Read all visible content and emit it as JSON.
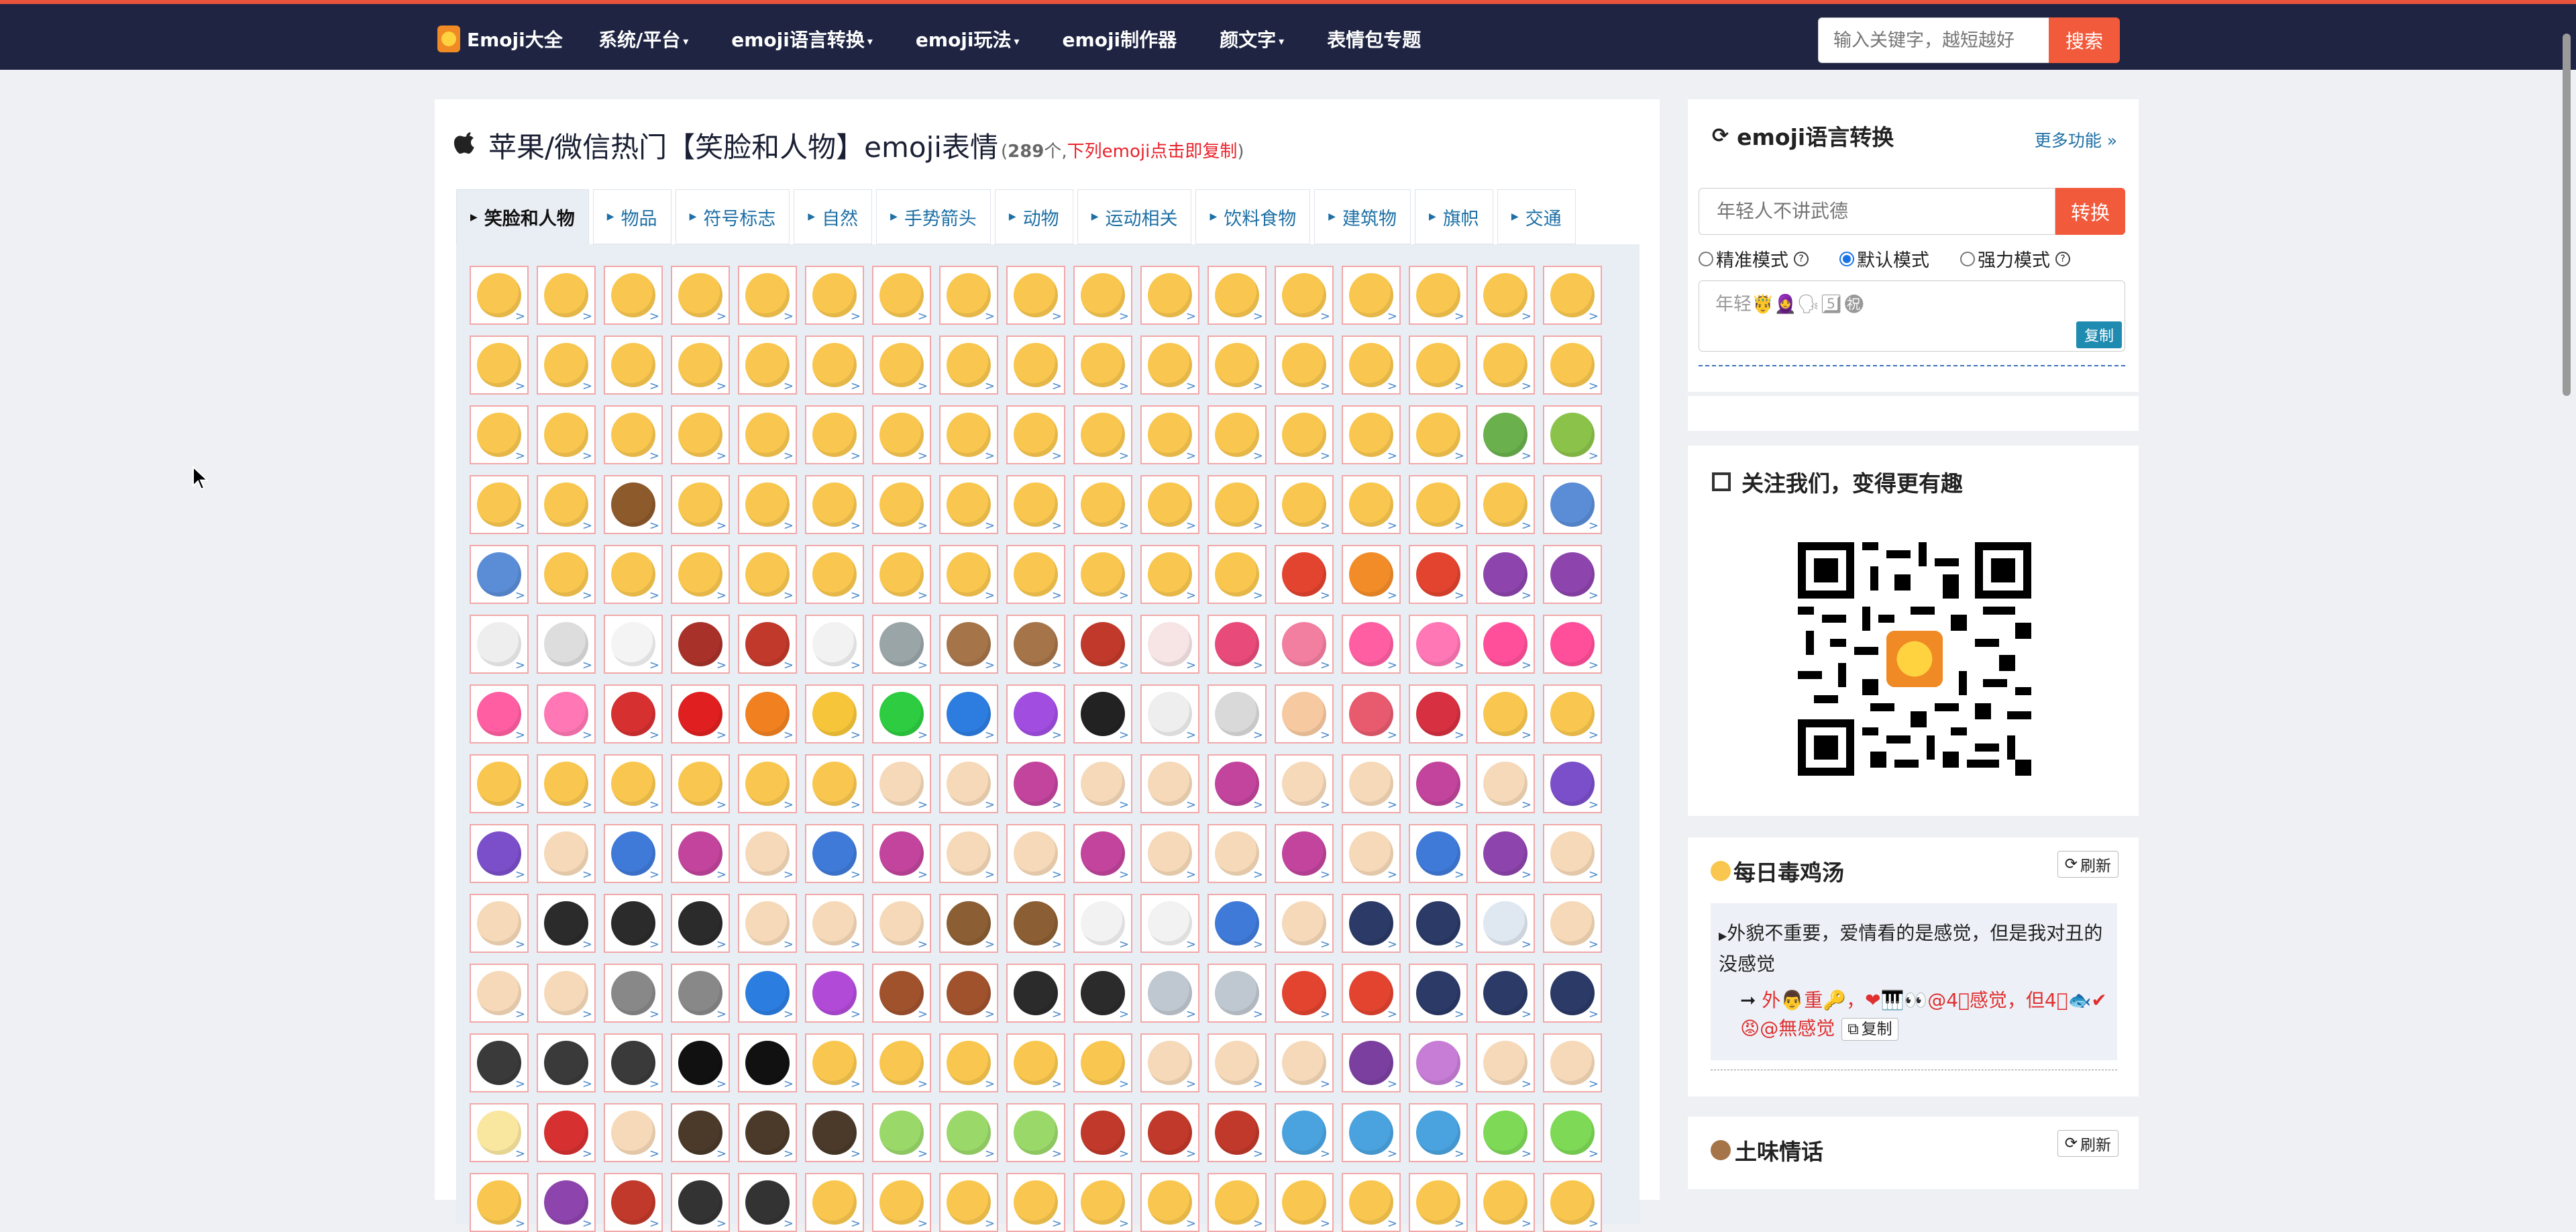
{
  "navbar": {
    "brand": "Emoji大全",
    "items": [
      {
        "label": "系统/平台",
        "dropdown": true
      },
      {
        "label": "emoji语言转换",
        "dropdown": true
      },
      {
        "label": "emoji玩法",
        "dropdown": true
      },
      {
        "label": "emoji制作器",
        "dropdown": false
      },
      {
        "label": "颜文字",
        "dropdown": true
      },
      {
        "label": "表情包专题",
        "dropdown": false
      }
    ],
    "search_placeholder": "输入关键字，越短越好",
    "search_button": "搜索"
  },
  "main": {
    "title": "苹果/微信热门【笑脸和人物】emoji表情",
    "count": "289",
    "count_suffix": "个,",
    "hint": "下列emoji点击即复制",
    "tabs": [
      {
        "label": "笑脸和人物",
        "active": true
      },
      {
        "label": "物品"
      },
      {
        "label": "符号标志"
      },
      {
        "label": "自然"
      },
      {
        "label": "手势箭头"
      },
      {
        "label": "动物"
      },
      {
        "label": "运动相关"
      },
      {
        "label": "饮料食物"
      },
      {
        "label": "建筑物"
      },
      {
        "label": "旗帜"
      },
      {
        "label": "交通"
      }
    ]
  },
  "emoji_grid": {
    "columns": 17,
    "rows": 14,
    "corner_glyph": ">",
    "colors": [
      "#f9c74f",
      "#f9c74f",
      "#f9c74f",
      "#f9c74f",
      "#f9c74f",
      "#f9c74f",
      "#f9c74f",
      "#f9c74f",
      "#f9c74f",
      "#f9c74f",
      "#f9c74f",
      "#f9c74f",
      "#f9c74f",
      "#f9c74f",
      "#f9c74f",
      "#f9c74f",
      "#f9c74f",
      "#f9c74f",
      "#f9c74f",
      "#f9c74f",
      "#f9c74f",
      "#f9c74f",
      "#f9c74f",
      "#f9c74f",
      "#f9c74f",
      "#f9c74f",
      "#f9c74f",
      "#f9c74f",
      "#f9c74f",
      "#f9c74f",
      "#f9c74f",
      "#f9c74f",
      "#f9c74f",
      "#f9c74f",
      "#f9c74f",
      "#f9c74f",
      "#f9c74f",
      "#f9c74f",
      "#f9c74f",
      "#f9c74f",
      "#f9c74f",
      "#f9c74f",
      "#f9c74f",
      "#f9c74f",
      "#f9c74f",
      "#f9c74f",
      "#f9c74f",
      "#f9c74f",
      "#f9c74f",
      "#6ab04c",
      "#8bc34a",
      "#f9c74f",
      "#f9c74f",
      "#8d5a2b",
      "#f9c74f",
      "#f9c74f",
      "#f9c74f",
      "#f9c74f",
      "#f9c74f",
      "#f9c74f",
      "#f9c74f",
      "#f9c74f",
      "#f9c74f",
      "#f9c74f",
      "#f9c74f",
      "#f9c74f",
      "#f9c74f",
      "#5b8dd6",
      "#5b8dd6",
      "#f9c74f",
      "#f9c74f",
      "#f9c74f",
      "#f9c74f",
      "#f9c74f",
      "#f9c74f",
      "#f9c74f",
      "#f9c74f",
      "#f9c74f",
      "#f9c74f",
      "#f9c74f",
      "#e2442f",
      "#f28c28",
      "#e2442f",
      "#8e44ad",
      "#8e44ad",
      "#eeeeee",
      "#dddddd",
      "#f4f4f4",
      "#a8322a",
      "#c0392b",
      "#f2f2f2",
      "#9aa5a8",
      "#a57449",
      "#a57449",
      "#c0392b",
      "#f7e4e4",
      "#e84a7a",
      "#f27ea0",
      "#ff5fa2",
      "#ff77b5",
      "#ff4f9a",
      "#ff4f9a",
      "#ff5fa2",
      "#ff77b5",
      "#d63031",
      "#e02020",
      "#f08020",
      "#f6c53a",
      "#2ecc40",
      "#2d7de0",
      "#a04de0",
      "#222222",
      "#eeeeee",
      "#d9d9d9",
      "#f7c9a0",
      "#e85b6f",
      "#d63041",
      "#f9c74f",
      "#f9c74f",
      "#f9c74f",
      "#f9c74f",
      "#f9c74f",
      "#f9c74f",
      "#f9c74f",
      "#f9c74f",
      "#f6d9b8",
      "#f6d9b8",
      "#c2449c",
      "#f6d9b8",
      "#f6d9b8",
      "#c2449c",
      "#f6d9b8",
      "#f6d9b8",
      "#c2449c",
      "#f6d9b8",
      "#7b4fc9",
      "#7b4fc9",
      "#f6d9b8",
      "#3f7ad8",
      "#c2449c",
      "#f6d9b8",
      "#3f7ad8",
      "#c2449c",
      "#f6d9b8",
      "#f6d9b8",
      "#c2449c",
      "#f6d9b8",
      "#f6d9b8",
      "#c2449c",
      "#f6d9b8",
      "#3f7ad8",
      "#8e44ad",
      "#f6d9b8",
      "#f6d9b8",
      "#2b2b2b",
      "#2b2b2b",
      "#2b2b2b",
      "#f6d9b8",
      "#f6d9b8",
      "#f6d9b8",
      "#8b5e34",
      "#8b5e34",
      "#f2f2f2",
      "#f2f2f2",
      "#3f7ad8",
      "#f6d9b8",
      "#2b3a67",
      "#2b3a67",
      "#dfe7f0",
      "#f6d9b8",
      "#f6d9b8",
      "#f6d9b8",
      "#888888",
      "#888888",
      "#2b7de0",
      "#b14ad6",
      "#a0522d",
      "#a0522d",
      "#2b2b2b",
      "#2b2b2b",
      "#bfc7d0",
      "#bfc7d0",
      "#e2442f",
      "#e2442f",
      "#2b3a67",
      "#2b3a67",
      "#2b3a67",
      "#3a3a3a",
      "#3a3a3a",
      "#3a3a3a",
      "#111111",
      "#111111",
      "#f9c74f",
      "#f9c74f",
      "#f9c74f",
      "#f9c74f",
      "#f9c74f",
      "#f6d9b8",
      "#f6d9b8",
      "#f6d9b8",
      "#7b3fa0",
      "#c77dd6",
      "#f6d9b8",
      "#f6d9b8",
      "#f9e79f",
      "#d63031",
      "#f6d9b8",
      "#4b3a2a",
      "#4b3a2a",
      "#4b3a2a",
      "#9bd86a",
      "#9bd86a",
      "#9bd86a",
      "#c0392b",
      "#c0392b",
      "#c0392b",
      "#4aa3df",
      "#4aa3df",
      "#4aa3df",
      "#7ed957",
      "#7ed957",
      "#f9c74f",
      "#8e44ad",
      "#c0392b",
      "#333333",
      "#333333",
      "#f9c74f",
      "#f9c74f",
      "#f9c74f",
      "#f9c74f",
      "#f9c74f",
      "#f9c74f",
      "#f9c74f",
      "#f9c74f",
      "#f9c74f",
      "#f9c74f",
      "#f9c74f",
      "#f9c74f"
    ]
  },
  "sidebar": {
    "converter": {
      "title": "emoji语言转换",
      "more": "更多功能 »",
      "input_placeholder": "年轻人不讲武德",
      "convert_button": "转换",
      "modes": [
        {
          "label": "精准模式",
          "checked": false,
          "help": true
        },
        {
          "label": "默认模式",
          "checked": true,
          "help": false
        },
        {
          "label": "强力模式",
          "checked": false,
          "help": true
        }
      ],
      "output_text": "年轻🤴🧕🗣5⃣㊗",
      "copy_label": "复制"
    },
    "follow": {
      "title": "关注我们，变得更有趣"
    },
    "daily": {
      "title": "每日毒鸡汤",
      "refresh": "刷新",
      "text": "外貌不重要，爱情看的是感觉，但是我对丑的没感觉",
      "emoji_text": "外👨重🔑，❤🎹👀@4⃣感觉，但4⃣🐟✔😡@無感觉",
      "copy_label": "复制"
    },
    "romance": {
      "title": "土味情话",
      "refresh": "刷新"
    }
  }
}
